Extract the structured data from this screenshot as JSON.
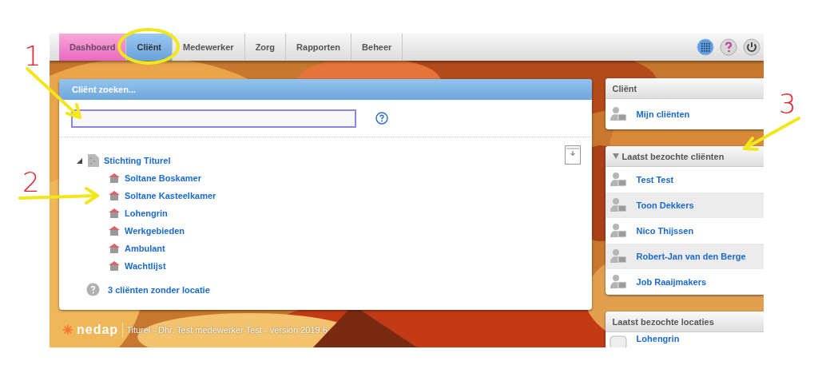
{
  "nav": {
    "tabs": [
      {
        "label": "Dashboard",
        "kind": "dashboard",
        "selected": false
      },
      {
        "label": "Cliënt",
        "kind": "module",
        "selected": true
      },
      {
        "label": "Medewerker",
        "kind": "module",
        "selected": false
      },
      {
        "label": "Zorg",
        "kind": "module",
        "selected": false
      },
      {
        "label": "Rapporten",
        "kind": "module",
        "selected": false
      },
      {
        "label": "Beheer",
        "kind": "module",
        "selected": false
      }
    ]
  },
  "search_panel": {
    "title": "Cliënt zoeken...",
    "tree": [
      {
        "label": "Stichting Titurel",
        "expanded": true,
        "children": [
          {
            "label": "Soltane Boskamer"
          },
          {
            "label": "Soltane Kasteelkamer"
          },
          {
            "label": "Lohengrin"
          },
          {
            "label": "Werkgebieden"
          },
          {
            "label": "Ambulant"
          },
          {
            "label": "Wachtlijst"
          }
        ]
      }
    ],
    "unassigned_link": "3 cliënten zonder locatie"
  },
  "footer": {
    "brand": "nedap",
    "text": "Titurel - Dhr. Test medewerker Test - version 2019.6"
  },
  "sidebar": {
    "cards": [
      {
        "title": "Cliënt",
        "kind": "section",
        "items": [
          "Mijn cliënten"
        ]
      },
      {
        "title": "Laatst bezochte cliënten",
        "kind": "collapsible",
        "expanded": true,
        "items": [
          "Test Test",
          "Toon Dekkers",
          "Nico Thijssen",
          "Robert-Jan van den Berge",
          "Job Raaijmakers"
        ]
      },
      {
        "title": "Laatst bezochte locaties",
        "kind": "section",
        "items": [
          "Lohengrin"
        ]
      }
    ]
  },
  "annotations": [
    {
      "label": "1"
    },
    {
      "label": "2"
    },
    {
      "label": "3"
    }
  ]
}
